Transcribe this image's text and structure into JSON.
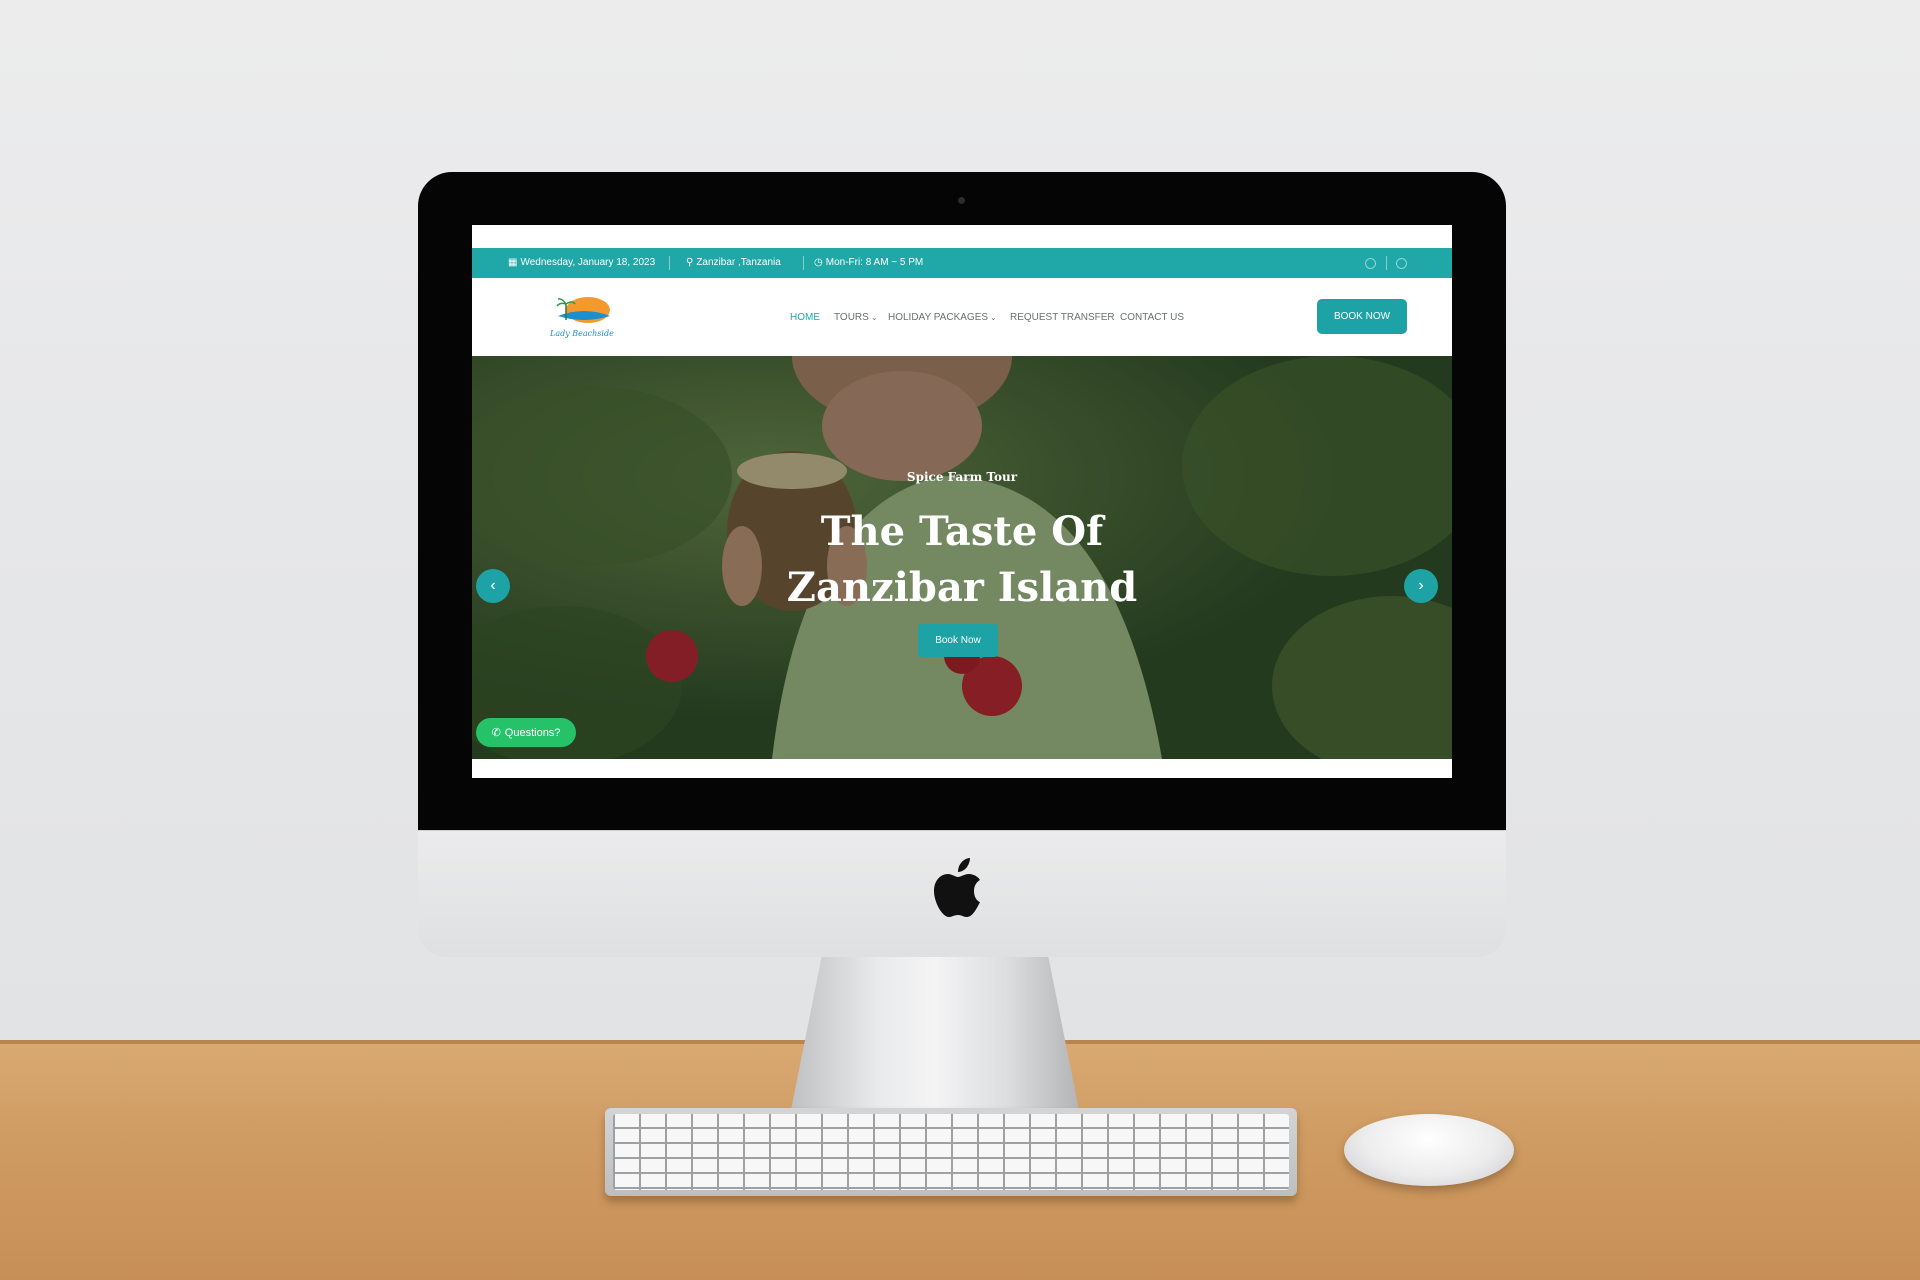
{
  "topbar": {
    "date": "Wednesday, January 18, 2023",
    "location": "Zanzibar ,Tanzania",
    "hours": "Mon-Fri: 8 AM ~ 5 PM",
    "social": [
      "facebook-icon",
      "instagram-icon"
    ]
  },
  "nav": {
    "items": [
      {
        "label": "HOME"
      },
      {
        "label": "TOURS"
      },
      {
        "label": "HOLIDAY PACKAGES"
      },
      {
        "label": "REQUEST TRANSFER"
      },
      {
        "label": "CONTACT US"
      }
    ],
    "active": "HOME",
    "book_label": "BOOK NOW"
  },
  "logo": {
    "text": "Lady Beachside"
  },
  "hero": {
    "subtitle": "Spice Farm Tour",
    "title_line1": "The Taste Of",
    "title_line2": "Zanzibar Island",
    "button_label": "Book Now"
  },
  "questions_label": "Questions?",
  "colors": {
    "accent": "#20a8a9",
    "whatsapp": "#25c26a",
    "nav_text": "#6b6f74"
  }
}
